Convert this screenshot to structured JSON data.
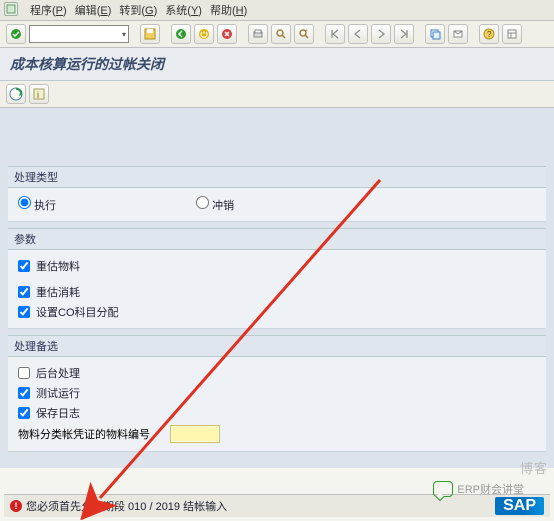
{
  "menu": {
    "items": [
      {
        "label": "程序",
        "mnemonic": "P"
      },
      {
        "label": "编辑",
        "mnemonic": "E"
      },
      {
        "label": "转到",
        "mnemonic": "G"
      },
      {
        "label": "系统",
        "mnemonic": "Y"
      },
      {
        "label": "帮助",
        "mnemonic": "H"
      }
    ]
  },
  "toolbar": {
    "combo_value": "",
    "icons": [
      "check",
      "save",
      "back",
      "exit",
      "cancel",
      "print",
      "find",
      "findnext",
      "firstpage",
      "prevpage",
      "nextpage",
      "lastpage",
      "newsession",
      "shortcut",
      "help",
      "layout"
    ]
  },
  "title": "成本核算运行的过帐关闭",
  "app_toolbar": {
    "icons": [
      "execute",
      "information"
    ]
  },
  "groups": {
    "proc_type": {
      "title": "处理类型",
      "radios": {
        "execute": {
          "label": "执行",
          "checked": true
        },
        "reverse": {
          "label": "冲销",
          "checked": false
        }
      }
    },
    "params": {
      "title": "参数",
      "reval_material": {
        "label": "重估物料",
        "checked": true
      },
      "reval_consumption": {
        "label": "重估消耗",
        "checked": true
      },
      "set_co_alloc": {
        "label": "设置CO科目分配",
        "checked": true
      }
    },
    "proc_opts": {
      "title": "处理备选",
      "background": {
        "label": "后台处理",
        "checked": false
      },
      "test_run": {
        "label": "测试运行",
        "checked": true
      },
      "save_log": {
        "label": "保存日志",
        "checked": true
      },
      "mat_doc_range_label": "物料分类帐凭证的物料编号",
      "mat_doc_range_value": ""
    }
  },
  "status": {
    "message": "您必须首先允许期段 010 / 2019 结帐输入"
  },
  "watermark": {
    "text": "ERP财会讲堂",
    "text2": "博客"
  },
  "sap_logo": "SAP"
}
